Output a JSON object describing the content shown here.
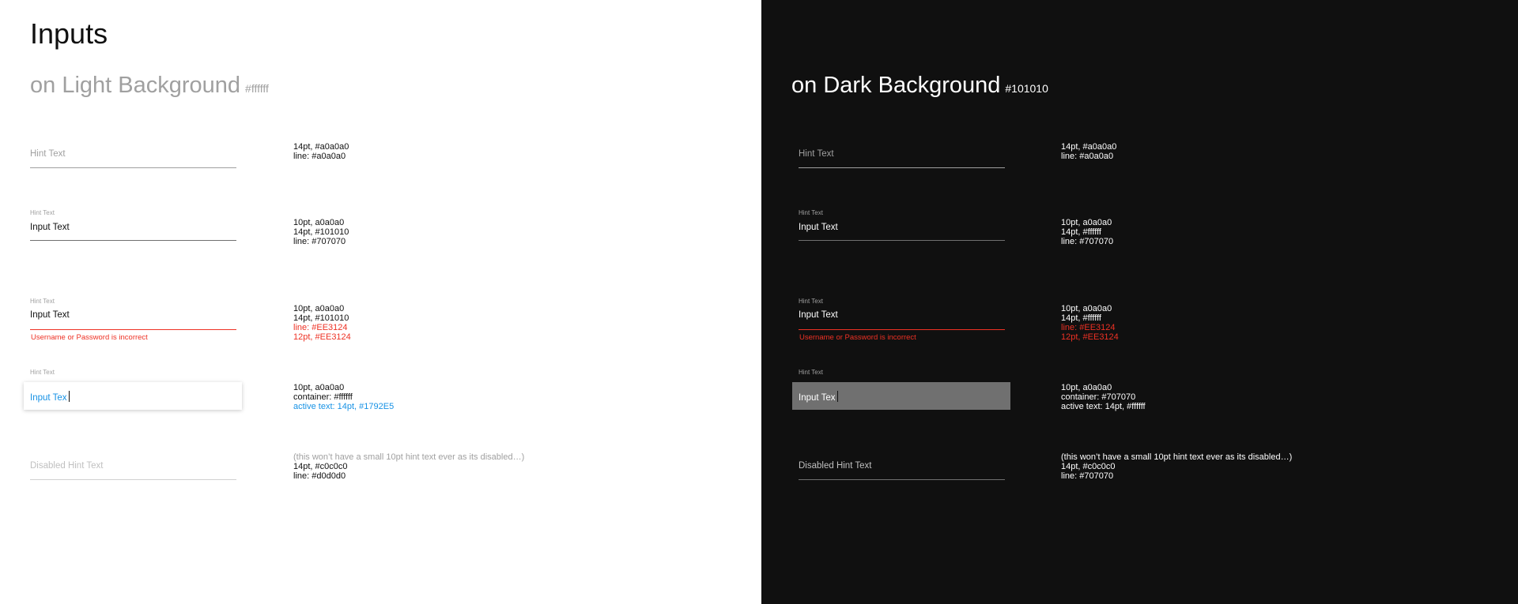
{
  "page_title": "Inputs",
  "colors": {
    "hint": "#a0a0a0",
    "input_text_light": "#101010",
    "input_text_dark": "#ffffff",
    "line_normal": "#707070",
    "error": "#EE3124",
    "active_text": "#1792E5",
    "disabled_text": "#c0c0c0",
    "disabled_line": "#d0d0d0",
    "dark_bg": "#101010",
    "dark_container": "#707070"
  },
  "light": {
    "title": "on Light Background",
    "title_hex": "#ffffff",
    "hint_field": {
      "hint": "Hint Text",
      "spec": [
        "14pt, #a0a0a0",
        "line: #a0a0a0"
      ]
    },
    "filled_field": {
      "small_hint": "Hint Text",
      "value": "Input Text",
      "spec": [
        "10pt, a0a0a0",
        "14pt, #101010",
        "line: #707070"
      ]
    },
    "error_field": {
      "small_hint": "Hint Text",
      "value": "Input Text",
      "error": "Username or Password is incorrect",
      "spec": [
        "10pt, a0a0a0",
        "14pt, #101010",
        "line: #EE3124",
        "12pt, #EE3124"
      ]
    },
    "active_field": {
      "small_hint": "Hint Text",
      "value": "Input Tex",
      "spec": [
        "10pt, a0a0a0",
        "container: #ffffff",
        "active text: 14pt, #1792E5"
      ]
    },
    "disabled_field": {
      "hint": "Disabled Hint Text",
      "spec": [
        "(this won’t have a small 10pt hint text ever as its disabled…)",
        "14pt, #c0c0c0",
        "line: #d0d0d0"
      ]
    }
  },
  "dark": {
    "title": "on Dark Background",
    "title_hex": "#101010",
    "hint_field": {
      "hint": "Hint Text",
      "spec": [
        "14pt, #a0a0a0",
        "line: #a0a0a0"
      ]
    },
    "filled_field": {
      "small_hint": "Hint Text",
      "value": "Input Text",
      "spec": [
        "10pt, a0a0a0",
        "14pt, #ffffff",
        "line: #707070"
      ]
    },
    "error_field": {
      "small_hint": "Hint Text",
      "value": "Input Text",
      "error": "Username or Password is incorrect",
      "spec": [
        "10pt, a0a0a0",
        "14pt, #ffffff",
        "line: #EE3124",
        "12pt, #EE3124"
      ]
    },
    "active_field": {
      "small_hint": "Hint Text",
      "value": "Input Tex",
      "spec": [
        "10pt, a0a0a0",
        "container: #707070",
        "active text: 14pt, #ffffff"
      ]
    },
    "disabled_field": {
      "hint": "Disabled Hint Text",
      "spec": [
        "(this won’t have a small 10pt hint text ever as its disabled…)",
        "14pt, #c0c0c0",
        "line: #707070"
      ]
    }
  }
}
